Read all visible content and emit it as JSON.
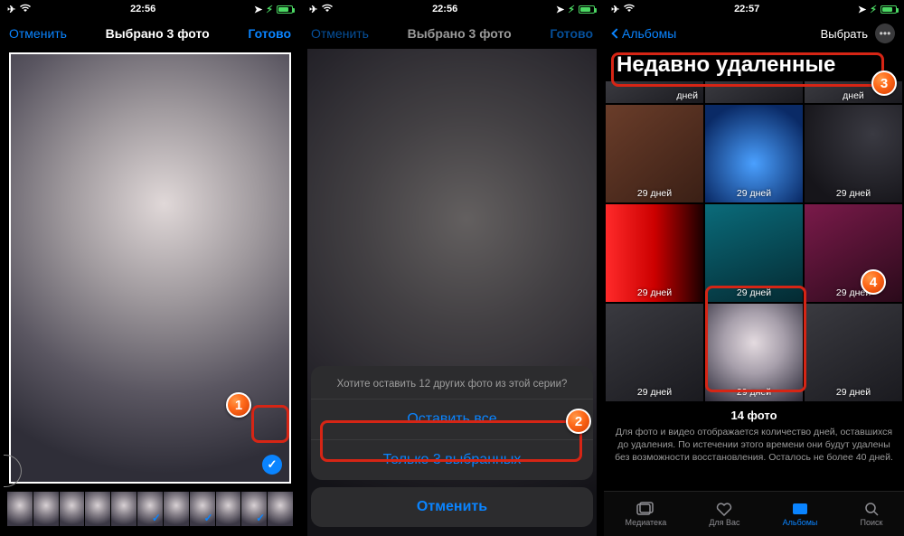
{
  "status": {
    "time1": "22:56",
    "time2": "22:56",
    "time3": "22:57"
  },
  "screen1": {
    "cancel": "Отменить",
    "title": "Выбрано 3 фото",
    "done": "Готово"
  },
  "screen2": {
    "cancel_nav": "Отменить",
    "title": "Выбрано 3 фото",
    "done": "Готово",
    "sheet_msg": "Хотите оставить 12 других фото из этой серии?",
    "keep_all": "Оставить все",
    "only_selected": "Только 3 выбранных",
    "cancel": "Отменить"
  },
  "screen3": {
    "back": "Альбомы",
    "select": "Выбрать",
    "heading": "Недавно удаленные",
    "days": "29 дней",
    "days_partial": "дней",
    "count": "14 фото",
    "note": "Для фото и видео отображается количество дней, оставшихся до удаления. По истечении этого времени они будут удалены без возможности восстановления. Осталось не более 40 дней.",
    "tabs": {
      "mediateka": "Медиатека",
      "dlya_vas": "Для Вас",
      "albums": "Альбомы",
      "search": "Поиск"
    }
  },
  "callouts": {
    "n1": "1",
    "n2": "2",
    "n3": "3",
    "n4": "4"
  }
}
